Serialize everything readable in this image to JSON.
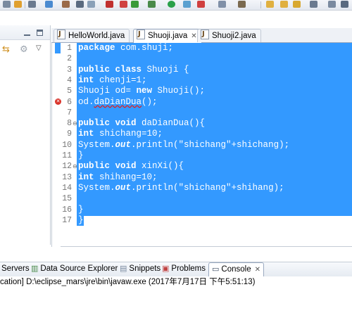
{
  "editor_tabs": [
    {
      "label": "HelloWorld.java",
      "active": false
    },
    {
      "label": "Shuoji.java",
      "active": true,
      "dirty": true
    },
    {
      "label": "Shuoji2.java",
      "active": false
    }
  ],
  "code": {
    "lines": [
      {
        "n": "1",
        "text": "package com.shuji;"
      },
      {
        "n": "2",
        "text": ""
      },
      {
        "n": "3",
        "text": "public class Shuoji {"
      },
      {
        "n": "4",
        "text": "int chenji=1;"
      },
      {
        "n": "5",
        "text": "Shuoji od= new Shuoji();"
      },
      {
        "n": "6",
        "text": "od.daDianDua();",
        "error": true
      },
      {
        "n": "7",
        "text": ""
      },
      {
        "n": "8",
        "text": "public void daDianDua(){",
        "fold": true
      },
      {
        "n": "9",
        "text": "int shichang=10;"
      },
      {
        "n": "10",
        "text": "System.out.println(\"shichang\"+shichang);"
      },
      {
        "n": "11",
        "text": "}"
      },
      {
        "n": "12",
        "text": "public void xinXi(){",
        "fold": true
      },
      {
        "n": "13",
        "text": "int shihang=10;"
      },
      {
        "n": "14",
        "text": "System.out.println(\"shichang\"+shihang);"
      },
      {
        "n": "15",
        "text": ""
      },
      {
        "n": "16",
        "text": "}"
      },
      {
        "n": "17",
        "text": "}"
      }
    ],
    "selection_color": "#3399ff"
  },
  "views": {
    "tabs": [
      {
        "label": "Servers",
        "icon": "servers-icon"
      },
      {
        "label": "Data Source Explorer",
        "icon": "data-source-icon"
      },
      {
        "label": "Snippets",
        "icon": "snippets-icon"
      },
      {
        "label": "Problems",
        "icon": "problems-icon"
      },
      {
        "label": "Console",
        "icon": "console-icon",
        "active": true
      }
    ],
    "close_glyph": "✕"
  },
  "console": {
    "text": "cation] D:\\eclipse_mars\\jre\\bin\\javaw.exe (2017年7月17日 下午5:51:13)"
  }
}
